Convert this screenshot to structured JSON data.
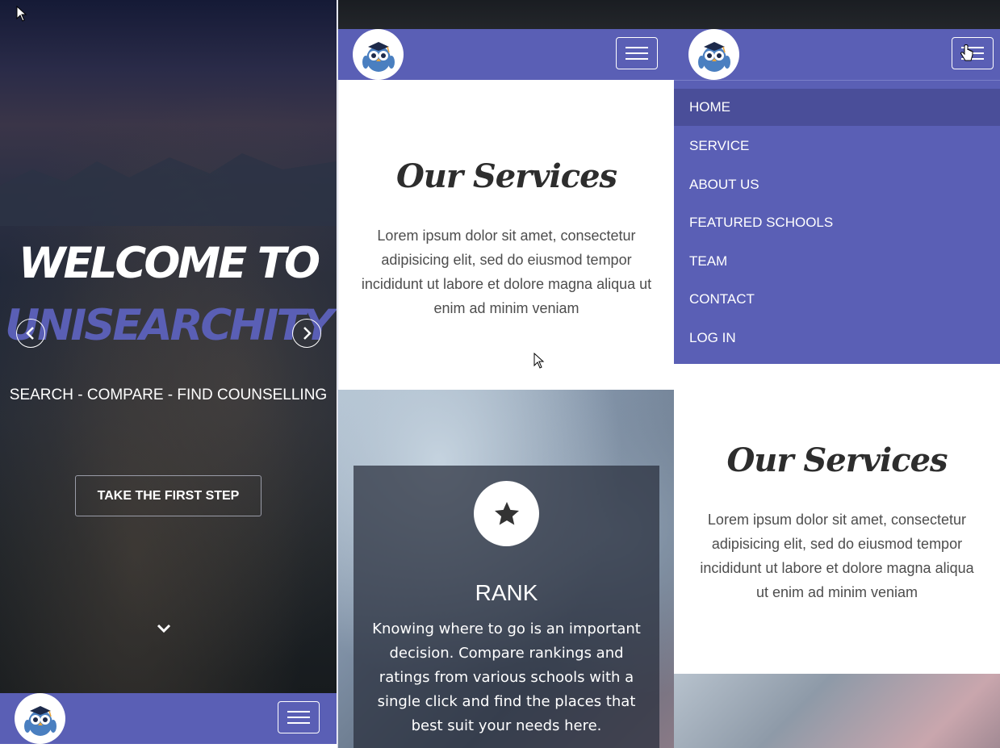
{
  "hero": {
    "title_line1": "WELCOME TO",
    "title_line2": "UNISEARCHITY",
    "subtitle": "SEARCH - COMPARE - FIND COUNSELLING",
    "cta_label": "TAKE THE FIRST STEP",
    "prev_icon": "chevron-left-icon",
    "next_icon": "chevron-right-icon",
    "scroll_icon": "chevron-down-icon"
  },
  "navbar": {
    "logo_icon": "owl-logo-icon",
    "menu_icon": "hamburger-icon"
  },
  "services": {
    "title": "Our Services",
    "description": "Lorem ipsum dolor sit amet, consectetur adipisicing elit, sed do eiusmod tempor incididunt ut labore et dolore magna aliqua ut enim ad minim veniam"
  },
  "rank_card": {
    "icon": "star-icon",
    "title": "RANK",
    "text": "Knowing where to go is an important decision. Compare rankings and ratings from various schools with a single click and find the places that best suit your needs here."
  },
  "menu": {
    "items": [
      {
        "label": "HOME",
        "active": true
      },
      {
        "label": "SERVICE"
      },
      {
        "label": "ABOUT US"
      },
      {
        "label": "FEATURED SCHOOLS"
      },
      {
        "label": "TEAM"
      },
      {
        "label": "CONTACT"
      },
      {
        "label": "LOG IN"
      }
    ]
  },
  "colors": {
    "brand": "#5a5fb5",
    "menu_active": "#4a4e99",
    "text_dark": "#2d2d2d",
    "text_body": "#4d4d4d"
  }
}
